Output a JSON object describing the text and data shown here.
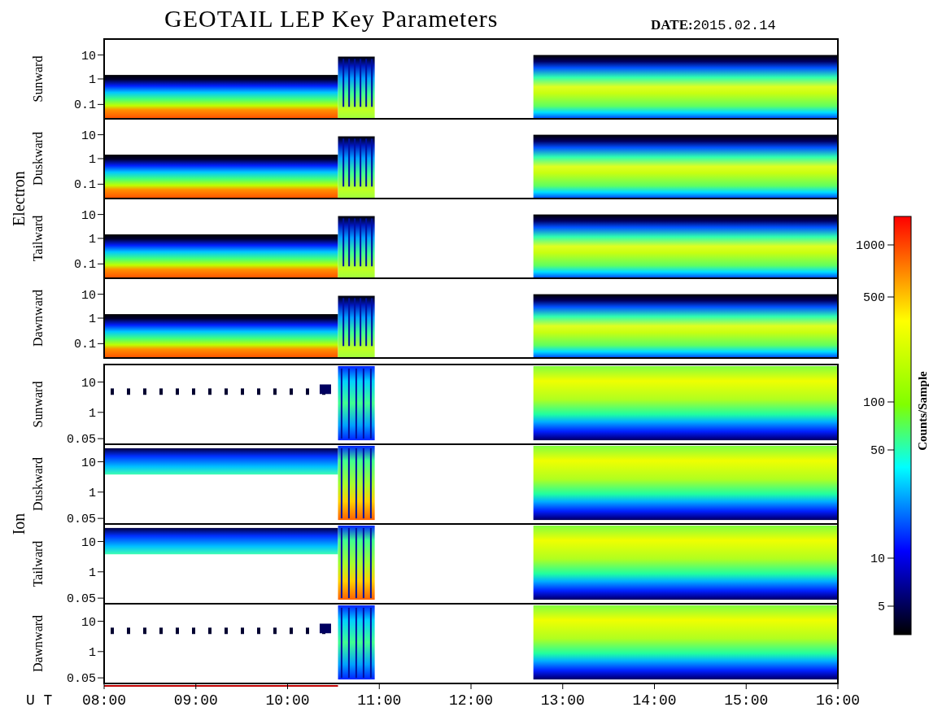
{
  "title": "GEOTAIL LEP Key Parameters",
  "date_label": "DATE:",
  "date": "2015.02.14",
  "groups": [
    {
      "name": "Electron",
      "kind": "electron",
      "panels": [
        {
          "label": "Sunward",
          "yticks": [
            "10",
            "1",
            "0.1"
          ]
        },
        {
          "label": "Duskward",
          "yticks": [
            "10",
            "1",
            "0.1"
          ]
        },
        {
          "label": "Tailward",
          "yticks": [
            "10",
            "1",
            "0.1"
          ]
        },
        {
          "label": "Dawnward",
          "yticks": [
            "10",
            "1",
            "0.1"
          ]
        }
      ]
    },
    {
      "name": "Ion",
      "kind": "ion",
      "panels": [
        {
          "label": "Sunward",
          "yticks": [
            "10",
            "1",
            "0.05"
          ]
        },
        {
          "label": "Duskward",
          "yticks": [
            "10",
            "1",
            "0.05"
          ]
        },
        {
          "label": "Tailward",
          "yticks": [
            "10",
            "1",
            "0.05"
          ]
        },
        {
          "label": "Dawnward",
          "yticks": [
            "10",
            "1",
            "0.05"
          ]
        }
      ]
    }
  ],
  "colorbar": {
    "title": "Counts/Sample",
    "ticks": [
      "1000",
      "500",
      "100",
      "50",
      "10",
      "5"
    ]
  },
  "xaxis": {
    "label": "U T",
    "ticks": [
      "08:00",
      "09:00",
      "10:00",
      "11:00",
      "12:00",
      "13:00",
      "14:00",
      "15:00",
      "16:00"
    ]
  }
}
